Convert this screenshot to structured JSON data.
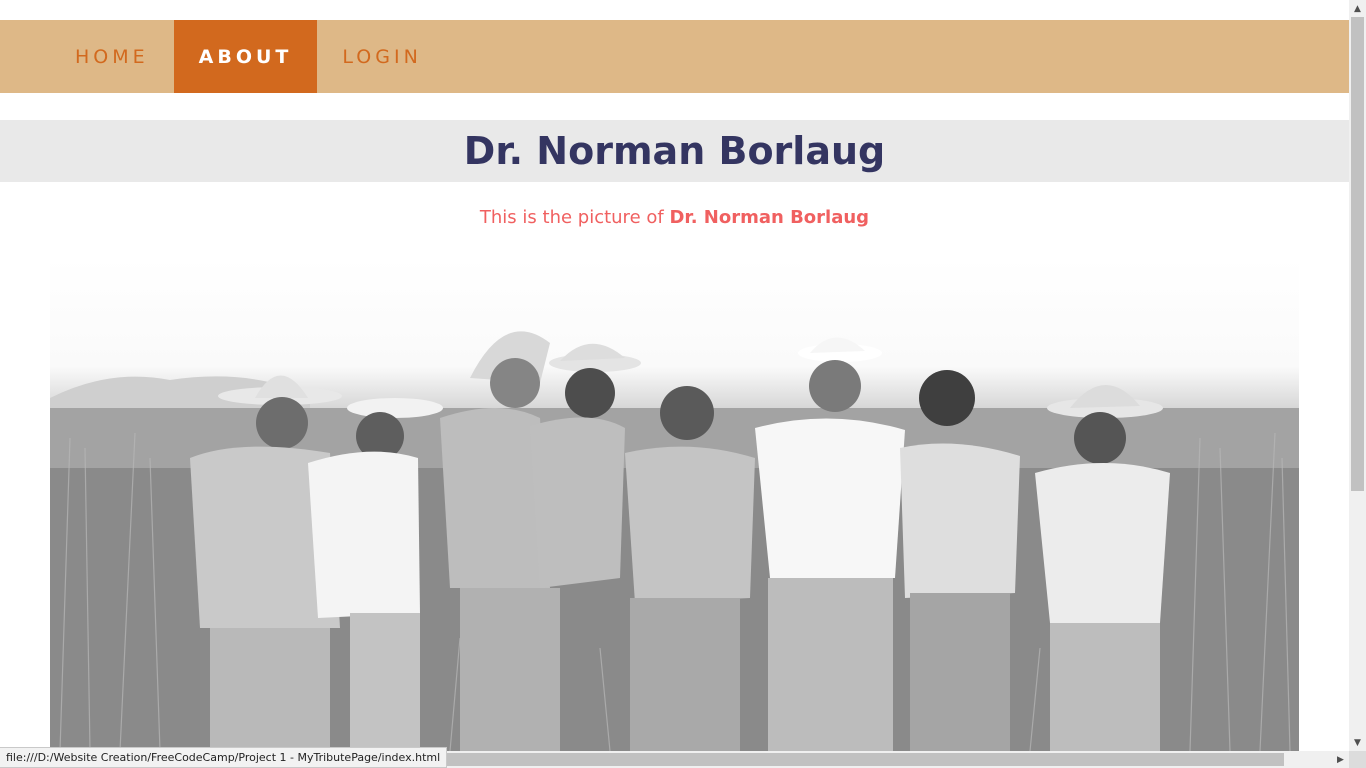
{
  "nav": {
    "items": [
      {
        "label": "HOME"
      },
      {
        "label": "ABOUT"
      },
      {
        "label": "LOGIN"
      }
    ],
    "active_index": 1
  },
  "header": {
    "title": "Dr. Norman Borlaug"
  },
  "caption": {
    "prefix": "This is the picture of ",
    "name": "Dr. Norman Borlaug"
  },
  "photo": {
    "icon": "photo-image",
    "tone": "black-and-white"
  },
  "status_bar": {
    "url": "file:///D:/Website Creation/FreeCodeCamp/Project 1 - MyTributePage/index.html"
  },
  "colors": {
    "nav_bg": "#deb887",
    "nav_active_bg": "#d2691e",
    "nav_text": "#d2691e",
    "title_bar_bg": "#e9e9e9",
    "title_text": "#343561",
    "caption_text": "#f06060"
  }
}
